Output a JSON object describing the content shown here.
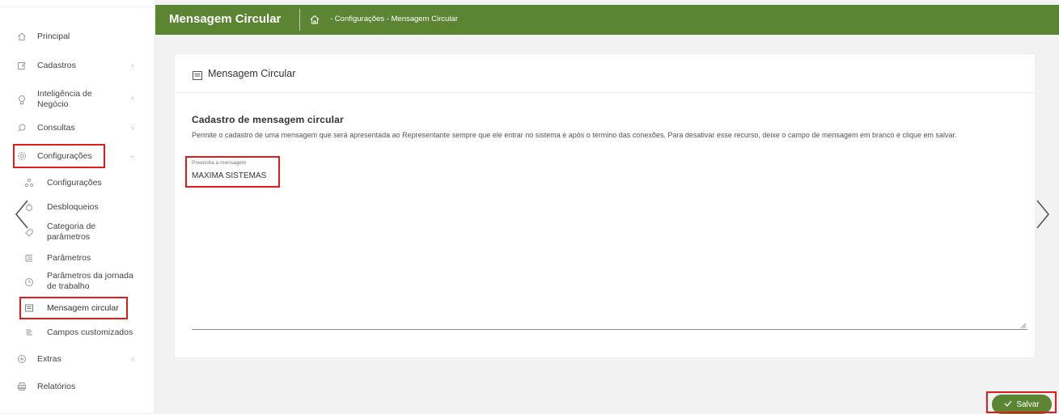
{
  "sidebar": {
    "items": [
      {
        "label": "Principal",
        "icon": "home-icon"
      },
      {
        "label": "Cadastros",
        "icon": "edit-icon"
      },
      {
        "label": "Inteligência de",
        "label2": "Negócio",
        "icon": "lightbulb-icon"
      },
      {
        "label": "Consultas",
        "icon": "search-icon"
      },
      {
        "label": "Configurações",
        "icon": "gear-icon"
      },
      {
        "label": "Extras",
        "icon": "plus-circle-icon"
      },
      {
        "label": "Relatórios",
        "icon": "printer-icon"
      }
    ],
    "subitems": [
      {
        "label": "Configurações",
        "icon": "sitemap-icon"
      },
      {
        "label": "Desbloqueios",
        "icon": "unlock-icon"
      },
      {
        "label": "Categoria de",
        "label2": "parâmetros",
        "icon": "tag-icon"
      },
      {
        "label": "Parâmetros",
        "icon": "list-icon"
      },
      {
        "label": "Parâmetros da jornada",
        "label2": "de trabalho",
        "icon": "clock-icon"
      },
      {
        "label": "Mensagem circular",
        "icon": "message-icon"
      },
      {
        "label": "Campos customizados",
        "icon": "fields-icon"
      }
    ]
  },
  "header": {
    "title": "Mensagem Circular",
    "breadcrumb": "- Configurações - Mensagem Circular"
  },
  "card": {
    "title": "Mensagem Circular",
    "section_title": "Cadastro de mensagem circular",
    "description": "Permite o cadastro de uma mensagem que será apresentada ao Representante sempre que ele entrar no sistema e após o termino das conexões. Para desativar esse recurso, deixe o campo de mensagem em branco e clique em salvar.",
    "field_label": "Preencha a mensagem",
    "field_value": "MAXIMA SISTEMAS"
  },
  "actions": {
    "save_label": "Salvar"
  },
  "colors": {
    "accent": "#5b8433",
    "highlight": "#e11c1c"
  }
}
